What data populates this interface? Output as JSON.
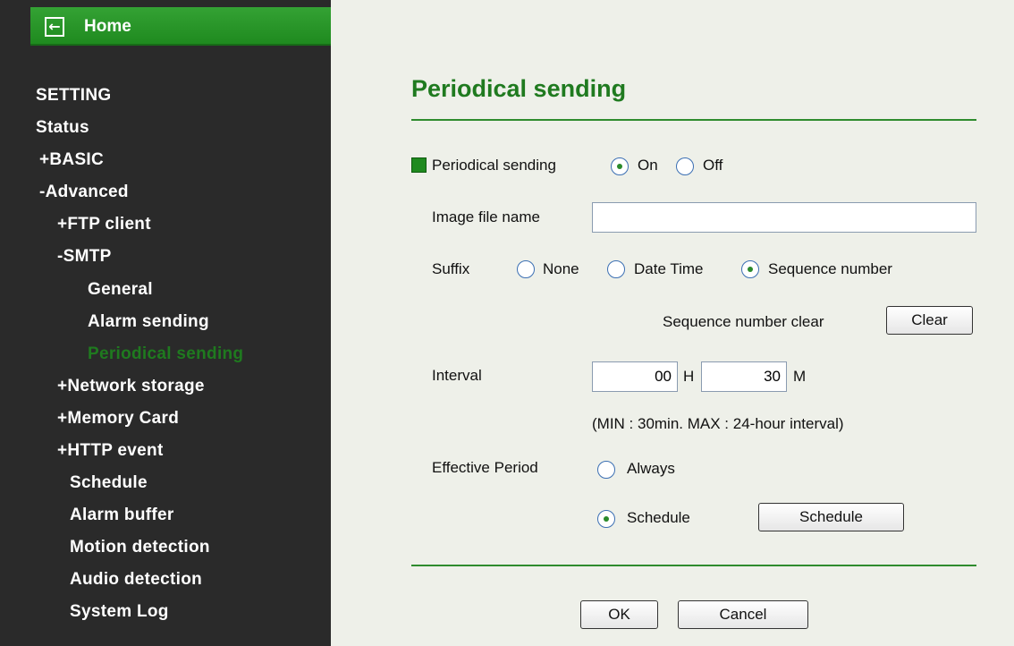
{
  "sidebar": {
    "home_label": "Home",
    "home_icon": "back-arrow-icon",
    "items": [
      {
        "label": "SETTING"
      },
      {
        "label": "Status"
      },
      {
        "label": "+BASIC"
      },
      {
        "label": "-Advanced"
      },
      {
        "label": "+FTP client"
      },
      {
        "label": "-SMTP"
      },
      {
        "label": "General"
      },
      {
        "label": "Alarm sending"
      },
      {
        "label": "Periodical sending",
        "active": true
      },
      {
        "label": "+Network storage"
      },
      {
        "label": "+Memory Card"
      },
      {
        "label": "+HTTP event"
      },
      {
        "label": "Schedule"
      },
      {
        "label": "Alarm buffer"
      },
      {
        "label": "Motion detection"
      },
      {
        "label": "Audio detection"
      },
      {
        "label": "System Log"
      }
    ],
    "accent_color": "#1f8a1f"
  },
  "main": {
    "title": "Periodical sending",
    "periodical": {
      "label": "Periodical sending",
      "on_label": "On",
      "off_label": "Off",
      "selected": "On"
    },
    "image_file_name": {
      "label": "Image file name",
      "value": ""
    },
    "suffix": {
      "label": "Suffix",
      "options": [
        "None",
        "Date Time",
        "Sequence number"
      ],
      "selected": "Sequence number"
    },
    "sequence_clear": {
      "label": "Sequence number clear",
      "button": "Clear"
    },
    "interval": {
      "label": "Interval",
      "hours": "00",
      "hours_unit": "H",
      "minutes": "30",
      "minutes_unit": "M",
      "note": "(MIN : 30min. MAX : 24-hour interval)"
    },
    "effective_period": {
      "label": "Effective Period",
      "always_label": "Always",
      "schedule_label": "Schedule",
      "schedule_button": "Schedule",
      "selected": "Schedule"
    },
    "ok_button": "OK",
    "cancel_button": "Cancel"
  }
}
